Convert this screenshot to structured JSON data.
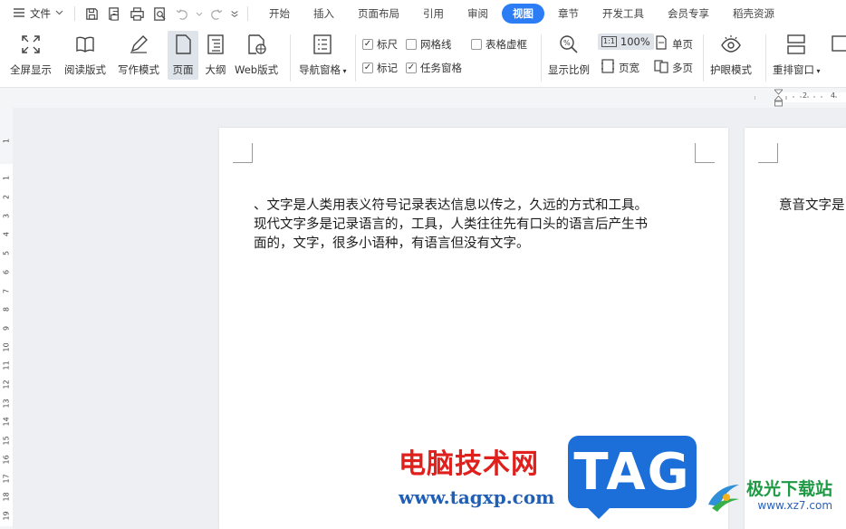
{
  "menubar": {
    "file_label": "文件",
    "tabs": [
      "开始",
      "插入",
      "页面布局",
      "引用",
      "审阅",
      "视图",
      "章节",
      "开发工具",
      "会员专享",
      "稻壳资源"
    ],
    "active_tab": "视图"
  },
  "ribbon": {
    "fullscreen": "全屏显示",
    "read_mode": "阅读版式",
    "write_mode": "写作模式",
    "page": "页面",
    "outline": "大纲",
    "web": "Web版式",
    "nav_pane": "导航窗格",
    "ruler": "标尺",
    "gridlines": "网格线",
    "table_gridlines": "表格虚框",
    "markup": "标记",
    "task_pane": "任务窗格",
    "zoom_ratio": "显示比例",
    "zoom_value": "100%",
    "one_to_one": "1:1",
    "single_page": "单页",
    "page_width": "页宽",
    "multi_page": "多页",
    "eye_protection": "护眼模式",
    "rearrange": "重排窗口",
    "checked": {
      "ruler": true,
      "gridlines": false,
      "table_gridlines": false,
      "markup": true,
      "task_pane": true
    }
  },
  "ruler": {
    "h_numbers": [
      "2",
      "4"
    ],
    "v_numbers": [
      "1",
      "1",
      "2",
      "3",
      "4",
      "5",
      "6",
      "7",
      "8",
      "9",
      "10",
      "11",
      "12",
      "13",
      "14",
      "15",
      "16",
      "17",
      "18",
      "19"
    ]
  },
  "document": {
    "page1_lines": [
      "、文字是人类用表义符号记录表达信息以传之，久远的方式和工具。",
      "现代文字多是记录语言的，工具，人类往往先有口头的语言后产生书",
      "面的，文字，很多小语种，有语言但没有文字。"
    ],
    "page2_text": "意音文字是"
  },
  "watermark": {
    "site_name": "电脑技术网",
    "site_url": "www.tagxp.com",
    "tag": "TAG",
    "logo_name": "极光下载站",
    "logo_url": "www.xz7.com"
  }
}
